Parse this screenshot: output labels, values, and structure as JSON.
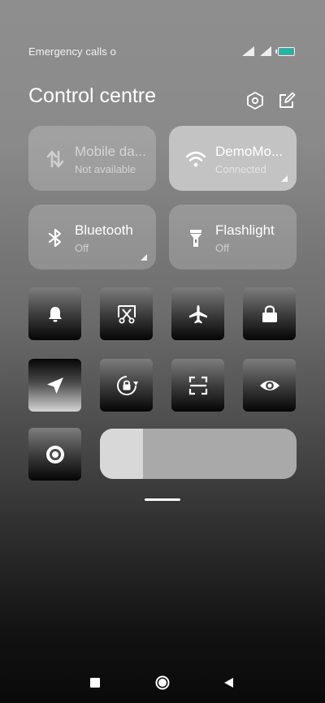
{
  "status_bar": {
    "carrier_text": "Emergency calls o",
    "battery_color": "#18b7a6"
  },
  "header": {
    "title": "Control centre",
    "settings_icon": "settings-hexagon-icon",
    "edit_icon": "edit-icon"
  },
  "big_tiles": [
    {
      "id": "mobile-data",
      "label": "Mobile da...",
      "sub": "Not available",
      "icon": "mobile-data-icon",
      "active": false
    },
    {
      "id": "wifi",
      "label": "DemoMo...",
      "sub": "Connected",
      "icon": "wifi-icon",
      "active": true
    },
    {
      "id": "bluetooth",
      "label": "Bluetooth",
      "sub": "Off",
      "icon": "bluetooth-icon",
      "active": false
    },
    {
      "id": "flashlight",
      "label": "Flashlight",
      "sub": "Off",
      "icon": "flashlight-icon",
      "active": false
    }
  ],
  "small_tiles": [
    {
      "id": "ring",
      "icon": "bell-icon",
      "active": false
    },
    {
      "id": "screenshot",
      "icon": "scissors-screenshot-icon",
      "active": false
    },
    {
      "id": "airplane",
      "icon": "airplane-icon",
      "active": false
    },
    {
      "id": "lock",
      "icon": "lock-icon",
      "active": false
    },
    {
      "id": "location",
      "icon": "location-arrow-icon",
      "active": true
    },
    {
      "id": "auto-rotate",
      "icon": "rotation-lock-icon",
      "active": false
    },
    {
      "id": "scanner",
      "icon": "scan-icon",
      "active": false
    },
    {
      "id": "reading-mode",
      "icon": "eye-icon",
      "active": false
    },
    {
      "id": "record",
      "icon": "record-icon",
      "active": false
    }
  ],
  "brightness": {
    "level": 0.22
  },
  "nav": {
    "recents_icon": "square-icon",
    "home_icon": "circle-icon",
    "back_icon": "triangle-back-icon"
  }
}
